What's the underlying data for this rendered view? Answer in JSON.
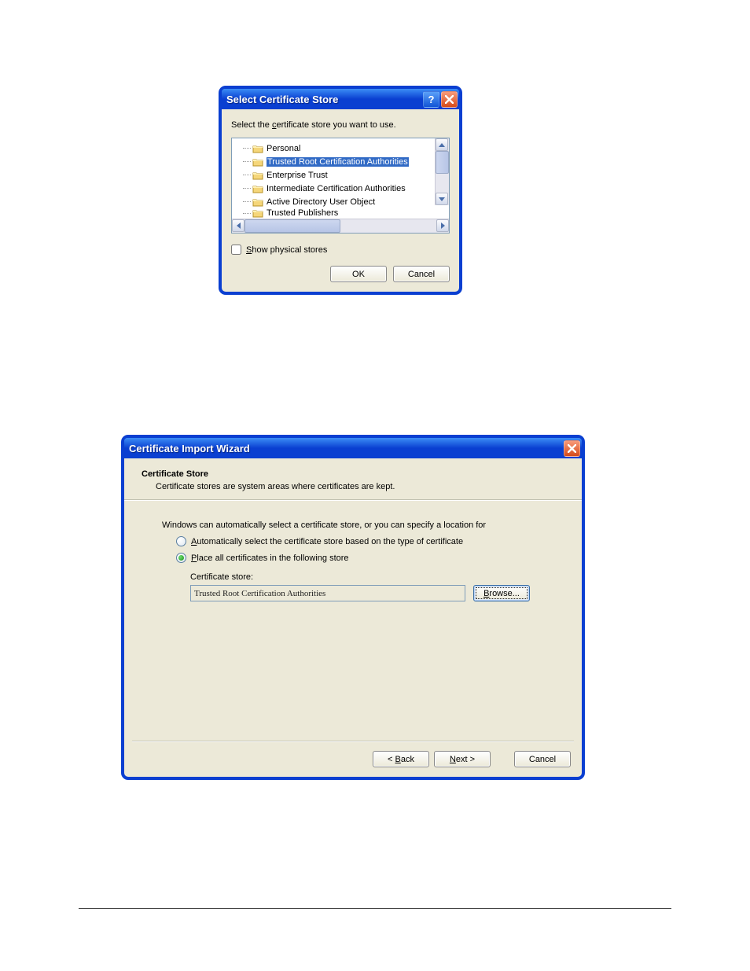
{
  "dialog1": {
    "title": "Select Certificate Store",
    "instruction": "Select the certificate store you want to use.",
    "tree_items": [
      {
        "label": "Personal",
        "selected": false
      },
      {
        "label": "Trusted Root Certification Authorities",
        "selected": true
      },
      {
        "label": "Enterprise Trust",
        "selected": false
      },
      {
        "label": "Intermediate Certification Authorities",
        "selected": false
      },
      {
        "label": "Active Directory User Object",
        "selected": false
      },
      {
        "label": "Trusted Publishers",
        "selected": false,
        "partial": true
      }
    ],
    "show_physical": "Show physical stores",
    "ok": "OK",
    "cancel": "Cancel"
  },
  "dialog2": {
    "title": "Certificate Import Wizard",
    "heading": "Certificate Store",
    "subheading": "Certificate stores are system areas where certificates are kept.",
    "intro": "Windows can automatically select a certificate store, or you can specify a location for",
    "radio_auto": "Automatically select the certificate store based on the type of certificate",
    "radio_place": "Place all certificates in the following store",
    "store_label": "Certificate store:",
    "store_value": "Trusted Root Certification Authorities",
    "browse": "Browse...",
    "back": "< Back",
    "next": "Next >",
    "cancel": "Cancel"
  }
}
